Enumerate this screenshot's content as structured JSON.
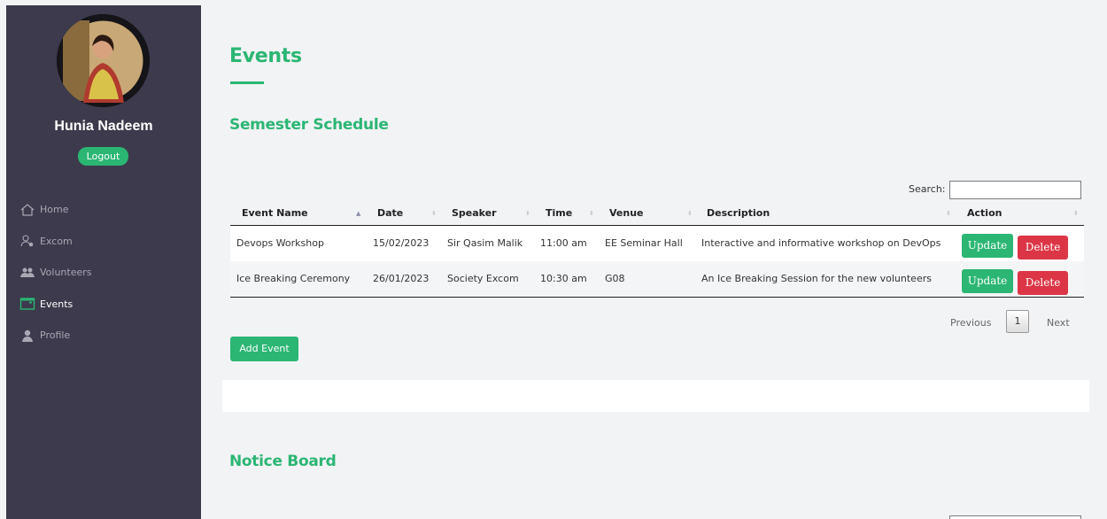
{
  "user": {
    "name": "Hunia Nadeem",
    "logout_label": "Logout"
  },
  "nav": {
    "items": [
      {
        "label": "Home",
        "icon": "home-icon",
        "active": false
      },
      {
        "label": "Excom",
        "icon": "user-cog-icon",
        "active": false
      },
      {
        "label": "Volunteers",
        "icon": "users-icon",
        "active": false
      },
      {
        "label": "Events",
        "icon": "calendar-icon",
        "active": true
      },
      {
        "label": "Profile",
        "icon": "person-icon",
        "active": false
      }
    ]
  },
  "page": {
    "title": "Events"
  },
  "schedule": {
    "title": "Semester Schedule",
    "search_label": "Search:",
    "search_value": "",
    "columns": [
      "Event Name",
      "Date",
      "Speaker",
      "Time",
      "Venue",
      "Description",
      "Action"
    ],
    "rows": [
      {
        "event_name": "Devops Workshop",
        "date": "15/02/2023",
        "speaker": "Sir Qasim Malik",
        "time": "11:00 am",
        "venue": "EE Seminar Hall",
        "description": "Interactive and informative workshop on DevOps",
        "update_label": "Update",
        "delete_label": "Delete"
      },
      {
        "event_name": "Ice Breaking Ceremony",
        "date": "26/01/2023",
        "speaker": "Society Excom",
        "time": "10:30 am",
        "venue": "G08",
        "description": "An Ice Breaking Session for the new volunteers",
        "update_label": "Update",
        "delete_label": "Delete"
      }
    ],
    "pager": {
      "previous_label": "Previous",
      "current_page": "1",
      "next_label": "Next"
    },
    "add_label": "Add Event"
  },
  "notice": {
    "title": "Notice Board"
  },
  "colors": {
    "accent": "#2bb673",
    "danger": "#dc3545",
    "sidebar": "#3c3a4c"
  }
}
